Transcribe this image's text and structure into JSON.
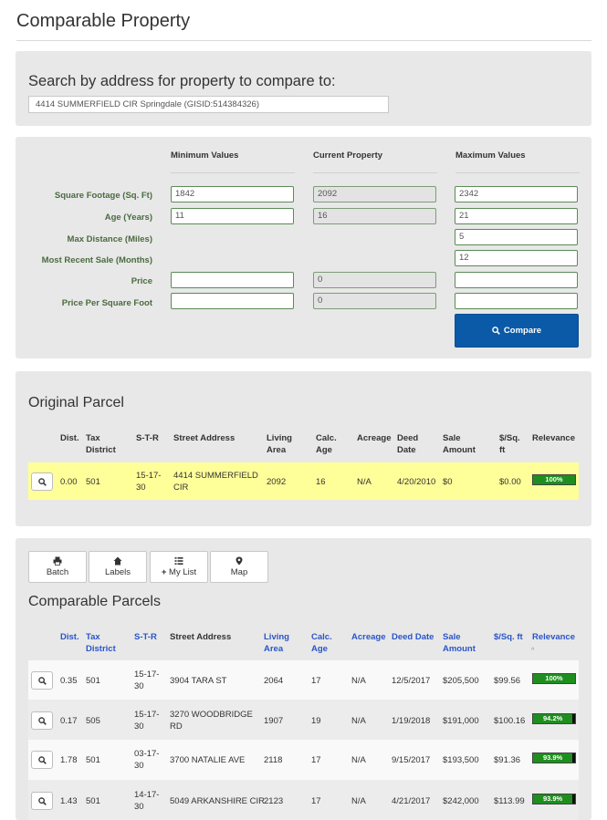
{
  "page": {
    "title": "Comparable Property"
  },
  "search": {
    "label": "Search by address for property to compare to:",
    "value": "4414 SUMMERFIELD CIR Springdale  (GISID:514384326)"
  },
  "criteria": {
    "headers": {
      "min": "Minimum Values",
      "current": "Current Property",
      "max": "Maximum Values"
    },
    "rows": [
      {
        "label": "Square Footage (Sq. Ft)",
        "min": "1842",
        "current": "2092",
        "max": "2342"
      },
      {
        "label": "Age (Years)",
        "min": "11",
        "current": "16",
        "max": "21"
      },
      {
        "label": "Max Distance (Miles)",
        "min": "",
        "current": "",
        "max": "5"
      },
      {
        "label": "Most Recent Sale (Months)",
        "min": "",
        "current": "",
        "max": "12"
      },
      {
        "label": "Price",
        "min": "",
        "current": "0",
        "max": ""
      },
      {
        "label": "Price Per Square Foot",
        "min": "",
        "current": "0",
        "max": ""
      }
    ],
    "compare_label": "Compare"
  },
  "table_headers": {
    "dist": "Dist.",
    "tax_district": [
      "Tax",
      "District"
    ],
    "str": "S-T-R",
    "street_address": "Street Address",
    "living_area": [
      "Living",
      "Area"
    ],
    "calc_age": [
      "Calc.",
      "Age"
    ],
    "acreage": "Acreage",
    "deed_date": [
      "Deed",
      "Date"
    ],
    "deed_date_single": "Deed Date",
    "sale_amount": [
      "Sale",
      "Amount"
    ],
    "price_per_sqft": [
      "$/Sq.",
      "ft"
    ],
    "price_per_sqft_single": "$/Sq. ft",
    "relevance": "Relevance"
  },
  "original": {
    "title": "Original Parcel",
    "row": {
      "dist": "0.00",
      "tax": "501",
      "str": [
        "15-17-",
        "30"
      ],
      "address": [
        "4414 SUMMERFIELD",
        "CIR"
      ],
      "living": "2092",
      "age": "16",
      "acreage": "N/A",
      "deed": "4/20/2010",
      "sale": "$0",
      "ppsf": "$0.00",
      "relevance": "100%",
      "relevance_pct": 100
    }
  },
  "toolbar": {
    "batch": "Batch",
    "labels": "Labels",
    "mylist": "My List",
    "map": "Map"
  },
  "comparable": {
    "title": "Comparable Parcels",
    "rows": [
      {
        "dist": "0.35",
        "tax": "501",
        "str": [
          "15-17-",
          "30"
        ],
        "address": [
          "3904 TARA ST",
          ""
        ],
        "living": "2064",
        "age": "17",
        "acreage": "N/A",
        "deed": "12/5/2017",
        "sale": "$205,500",
        "ppsf": "$99.56",
        "relevance": "100%",
        "relevance_pct": 100
      },
      {
        "dist": "0.17",
        "tax": "505",
        "str": [
          "15-17-",
          "30"
        ],
        "address": [
          "3270 WOODBRIDGE",
          "RD"
        ],
        "living": "1907",
        "age": "19",
        "acreage": "N/A",
        "deed": "1/19/2018",
        "sale": "$191,000",
        "ppsf": "$100.16",
        "relevance": "94.2%",
        "relevance_pct": 94.2
      },
      {
        "dist": "1.78",
        "tax": "501",
        "str": [
          "03-17-",
          "30"
        ],
        "address": [
          "3700 NATALIE AVE",
          ""
        ],
        "living": "2118",
        "age": "17",
        "acreage": "N/A",
        "deed": "9/15/2017",
        "sale": "$193,500",
        "ppsf": "$91.36",
        "relevance": "93.9%",
        "relevance_pct": 93.9
      },
      {
        "dist": "1.43",
        "tax": "501",
        "str": [
          "14-17-",
          "30"
        ],
        "address": [
          "5049 ARKANSHIRE CIR",
          ""
        ],
        "living": "2123",
        "age": "17",
        "acreage": "N/A",
        "deed": "4/21/2017",
        "sale": "$242,000",
        "ppsf": "$113.99",
        "relevance": "93.9%",
        "relevance_pct": 93.9
      }
    ]
  },
  "colors": {
    "accent": "#0b5aa8",
    "highlight": "#ffff99",
    "relevance": "#1e8f1e",
    "label_green": "#4a6b40"
  }
}
